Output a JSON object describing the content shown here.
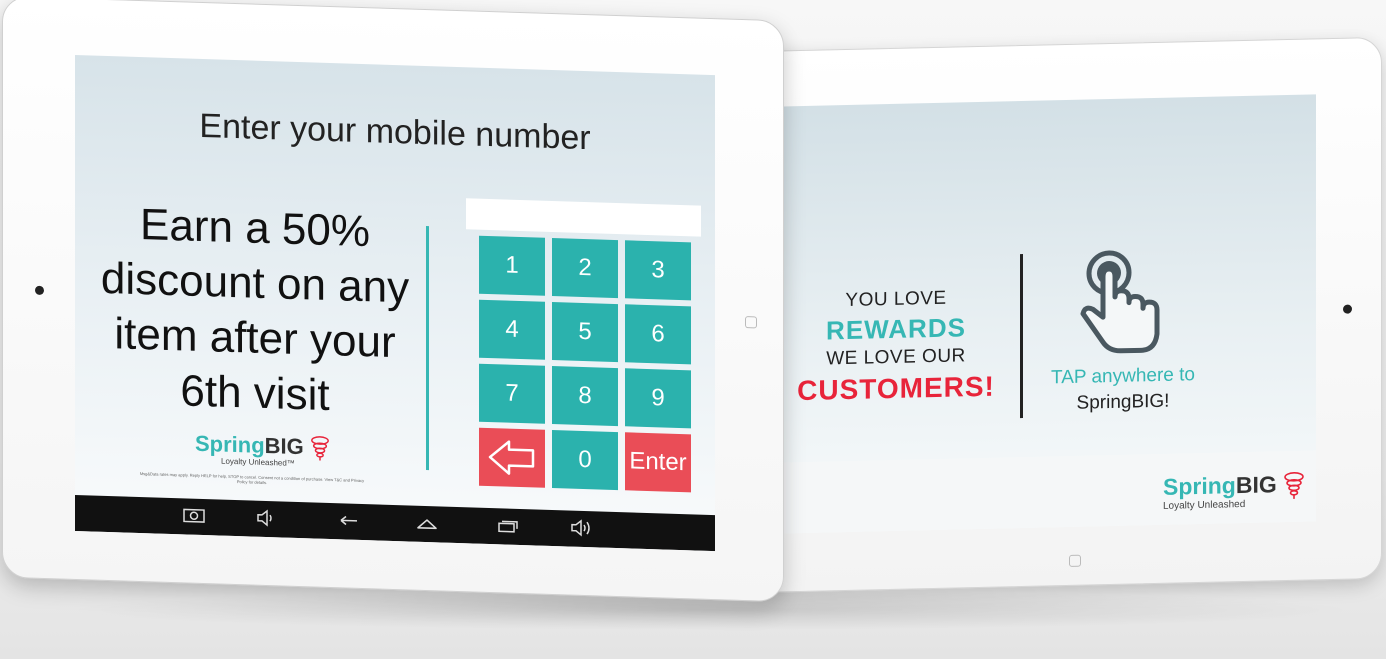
{
  "right_tablet": {
    "lines": [
      "YOU LOVE",
      "REWARDS",
      "WE LOVE OUR",
      "CUSTOMERS!"
    ],
    "tap_line1": "TAP anywhere to",
    "tap_line2": "SpringBIG!",
    "brand_spring": "Spring",
    "brand_big": "BIG",
    "brand_tagline": "Loyalty Unleashed",
    "hand_icon": "tap-hand-icon"
  },
  "left_tablet": {
    "title": "Enter your mobile number",
    "promo": "Earn a 50% discount on any item after your 6th visit",
    "phone_value": "",
    "keys": [
      "1",
      "2",
      "3",
      "4",
      "5",
      "6",
      "7",
      "8",
      "9",
      "back",
      "0",
      "Enter"
    ],
    "brand_spring": "Spring",
    "brand_big": "BIG",
    "brand_tagline": "Loyalty Unleashed™",
    "fine_print": "Msg&Data rates may apply. Reply HELP for help, STOP to cancel. Consent not a condition of purchase. View T&C and Privacy Policy for details.",
    "nav_icons": [
      "camera-icon",
      "volume-down-icon",
      "back-icon",
      "home-icon",
      "recent-apps-icon",
      "volume-up-icon"
    ]
  },
  "colors": {
    "teal": "#2bb2ad",
    "red": "#ea4d57",
    "brand_red": "#e8243a"
  }
}
